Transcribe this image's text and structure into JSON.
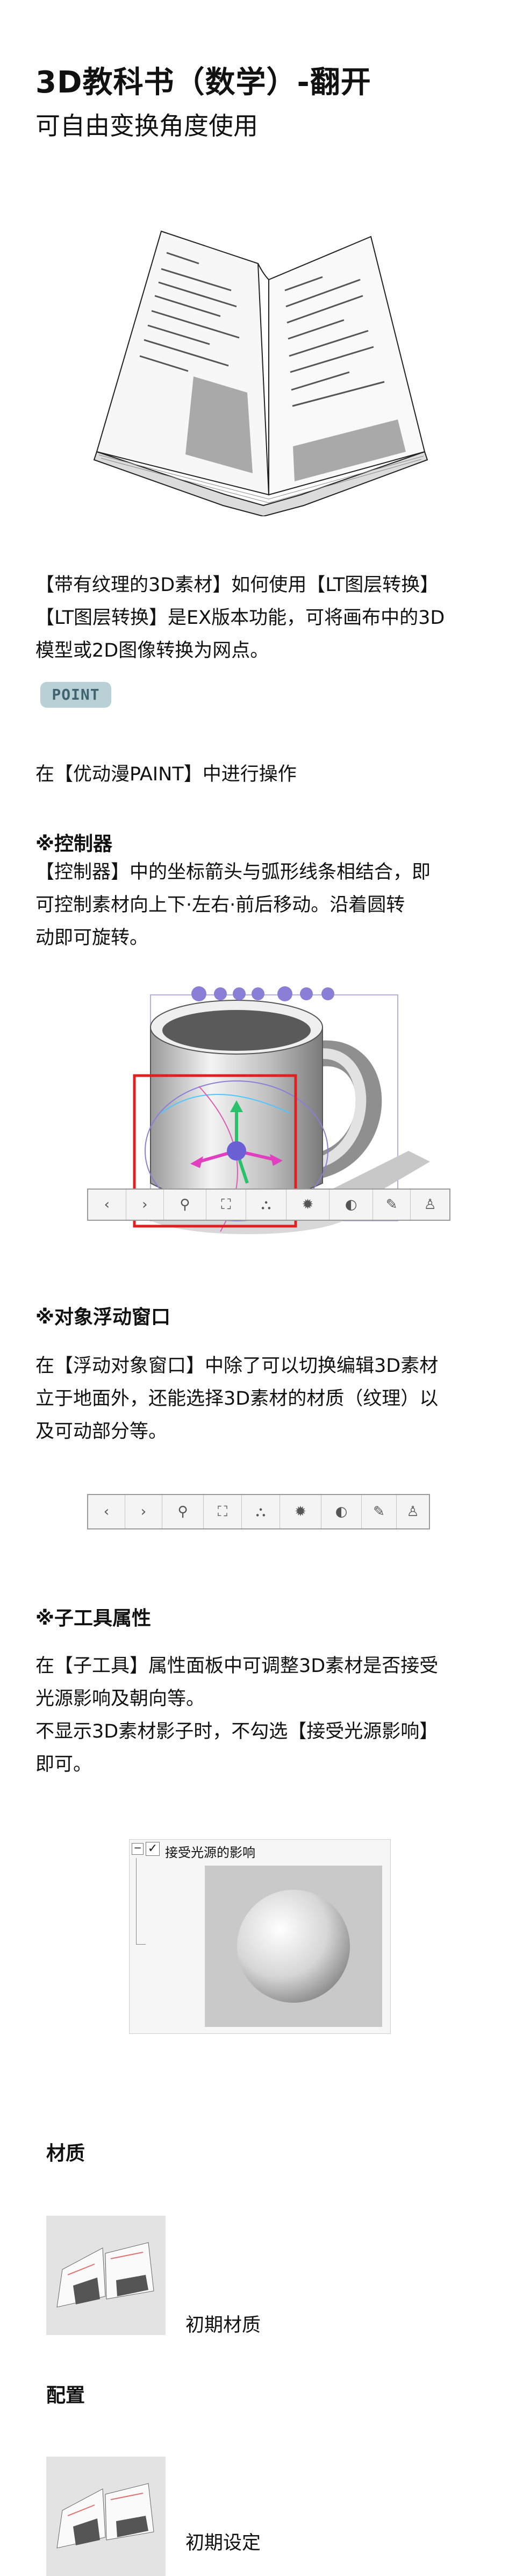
{
  "header": {
    "title": "3D教科书（数学）-翻开",
    "subtitle": "可自由变换角度使用"
  },
  "intro": {
    "line1": "【带有纹理的3D素材】如何使用【LT图层转换】",
    "line2": "【LT图层转换】是EX版本功能，可将画布中的3D",
    "line3": "模型或2D图像转换为网点。"
  },
  "point_badge": "POINT",
  "point_text": "在【优动漫PAINT】中进行操作",
  "controller": {
    "heading": "※控制器",
    "line1": "【控制器】中的坐标箭头与弧形线条相结合，即",
    "line2": "可控制素材向上下·左右·前后移动。沿着圆转",
    "line3": "动即可旋转。"
  },
  "float_window": {
    "heading": "※对象浮动窗口",
    "line1": "在【浮动对象窗口】中除了可以切换编辑3D素材",
    "line2": "立于地面外，还能选择3D素材的材质（纹理）以",
    "line3": "及可动部分等。"
  },
  "sub_tool": {
    "heading": "※子工具属性",
    "line1": "在【子工具】属性面板中可调整3D素材是否接受",
    "line2": "光源影响及朝向等。",
    "line3": "不显示3D素材影子时，不勾选【接受光源影响】",
    "line4": "即可。",
    "checkbox_label": "接受光源的影响"
  },
  "material": {
    "heading": "材质",
    "caption": "初期材质"
  },
  "layout": {
    "heading": "配置",
    "caption": "初期设定"
  },
  "toolbar_icons": [
    "chevron-left-icon",
    "chevron-right-icon",
    "camera-icon",
    "fit-frame-icon",
    "ground-icon",
    "light-icon",
    "material-icon",
    "paint-icon",
    "pose-icon"
  ],
  "colors": {
    "badge_bg": "#b9d0d6",
    "badge_text": "#3f6470",
    "highlight_red": "#e02020",
    "gizmo_purple": "#8a7fd6"
  }
}
